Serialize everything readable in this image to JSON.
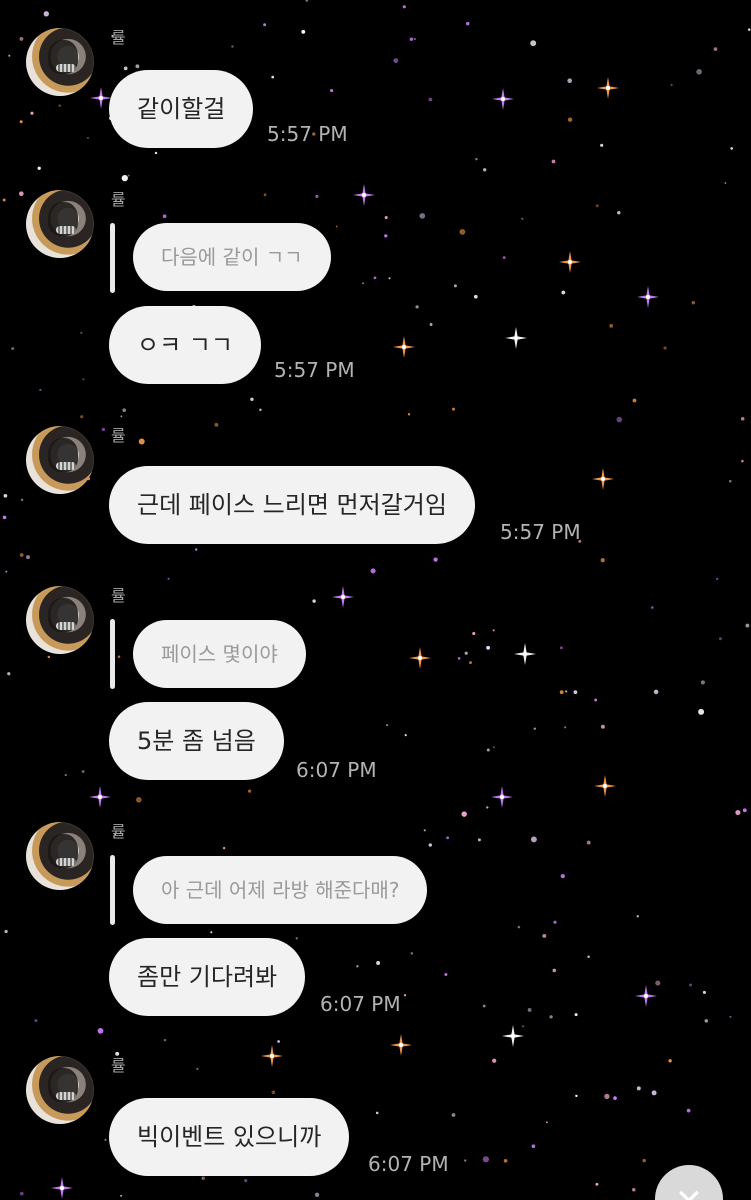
{
  "conversation": {
    "messages": [
      {
        "sender": "률",
        "text": "같이할걸",
        "time": "5:57 PM"
      },
      {
        "sender": "률",
        "reply_to": "다음에 같이 ㄱㄱ",
        "text": "ㅇㅋ ㄱㄱ",
        "time": "5:57 PM"
      },
      {
        "sender": "률",
        "text": "근데 페이스 느리면 먼저갈거임",
        "time": "5:57 PM"
      },
      {
        "sender": "률",
        "reply_to": "페이스 몇이야",
        "text": "5분 좀 넘음",
        "time": "6:07 PM"
      },
      {
        "sender": "률",
        "reply_to": "아 근데 어제 라방 해준다매?",
        "text": "좀만 기다려봐",
        "time": "6:07 PM"
      },
      {
        "sender": "률",
        "text": "빅이벤트 있으니까",
        "time": "6:07 PM"
      }
    ]
  },
  "theme": {
    "background": "#000000",
    "bubble_color": "#f2f2f2",
    "quote_color": "#f2f2f2",
    "reply_bar_color": "#e9e9e9",
    "sender_color": "#a7a7a7",
    "time_color": "#b3b3b3",
    "star_colors": [
      "#ffffff",
      "#f1d7ff",
      "#d07cff",
      "#ff9e4a",
      "#f6a7d7"
    ]
  },
  "icons": {
    "close": "close-icon"
  }
}
